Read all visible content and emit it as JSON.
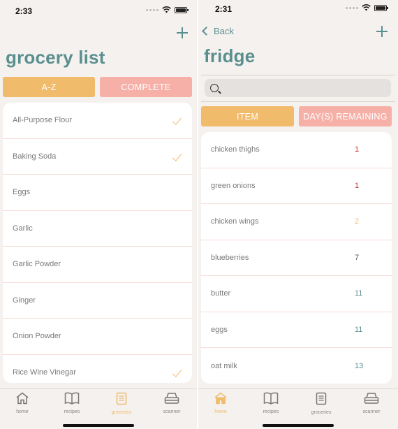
{
  "colors": {
    "accent": "#5a8f90",
    "orange": "#f1bb6c",
    "pink": "#f6b0a8",
    "red": "#c9302c",
    "teal": "#5a8f90"
  },
  "left": {
    "status": {
      "time": "2:33"
    },
    "title": "grocery list",
    "segments": {
      "a": "A-Z",
      "b": "COMPLETE"
    },
    "items": [
      {
        "name": "All-Purpose Flour",
        "checked": true
      },
      {
        "name": "Baking Soda",
        "checked": true
      },
      {
        "name": "Eggs",
        "checked": false
      },
      {
        "name": "Garlic",
        "checked": false
      },
      {
        "name": "Garlic Powder",
        "checked": false
      },
      {
        "name": "Ginger",
        "checked": false
      },
      {
        "name": "Onion Powder",
        "checked": false
      },
      {
        "name": "Rice Wine Vinegar",
        "checked": true
      }
    ],
    "tabs": [
      {
        "label": "home",
        "icon": "home-icon"
      },
      {
        "label": "recipes",
        "icon": "book-icon"
      },
      {
        "label": "groceries",
        "icon": "notepad-icon"
      },
      {
        "label": "scanner",
        "icon": "scanner-icon"
      }
    ],
    "active_tab": "groceries"
  },
  "right": {
    "status": {
      "time": "2:31"
    },
    "back_label": "Back",
    "title": "fridge",
    "search": {
      "placeholder": ""
    },
    "segments": {
      "a": "ITEM",
      "b": "DAY(S) REMAINING"
    },
    "items": [
      {
        "name": "chicken thighs",
        "days": "1",
        "color": "#c9302c"
      },
      {
        "name": "green onions",
        "days": "1",
        "color": "#c9302c"
      },
      {
        "name": "chicken wings",
        "days": "2",
        "color": "#f1bb6c"
      },
      {
        "name": "blueberries",
        "days": "7",
        "color": "#555555"
      },
      {
        "name": "butter",
        "days": "11",
        "color": "#5a8f90"
      },
      {
        "name": "eggs",
        "days": "11",
        "color": "#5a8f90"
      },
      {
        "name": "oat milk",
        "days": "13",
        "color": "#5a8f90"
      }
    ],
    "tabs": [
      {
        "label": "home",
        "icon": "home-icon"
      },
      {
        "label": "recipes",
        "icon": "book-icon"
      },
      {
        "label": "groceries",
        "icon": "notepad-icon"
      },
      {
        "label": "scanner",
        "icon": "scanner-icon"
      }
    ],
    "active_tab": "home"
  }
}
